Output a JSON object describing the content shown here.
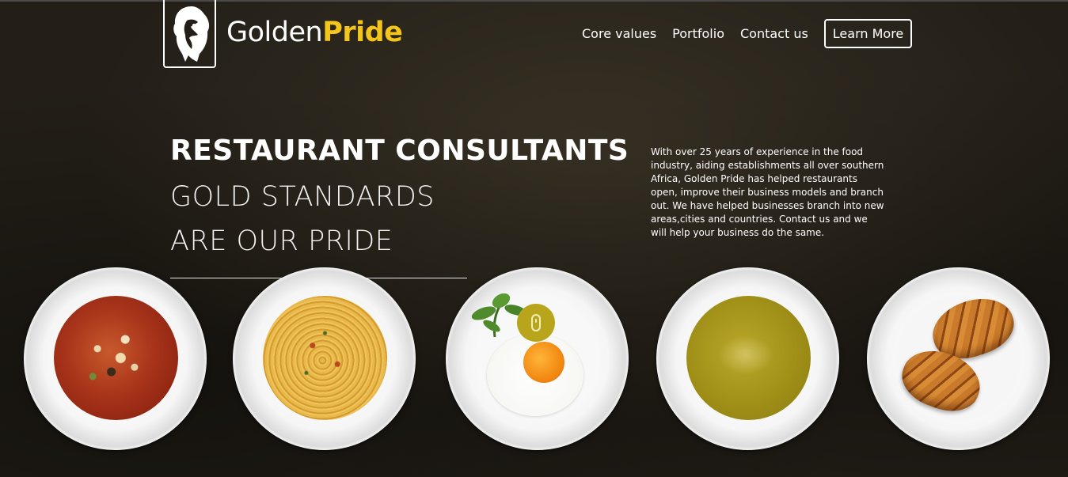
{
  "brand": {
    "name_part1": "Golden",
    "name_part2": "Pride",
    "accent_color": "#f4c51b",
    "logo_icon": "lion-head-icon"
  },
  "nav": {
    "items": [
      {
        "label": "Core values"
      },
      {
        "label": "Portfolio"
      },
      {
        "label": "Contact us"
      }
    ],
    "cta_label": "Learn More"
  },
  "hero": {
    "headline": "RESTAURANT CONSULTANTS",
    "subline_1": "GOLD STANDARDS",
    "subline_2": "ARE OUR PRIDE",
    "blurb": "With over 25 years of experience in the food industry, aiding establishments all over southern Africa, Golden Pride has helped restaurants open, improve their business models and branch out. We have helped businesses branch into new areas,cities and countries. Contact us and we will help your business do the same."
  },
  "plates": [
    {
      "dish": "vegetable-soup-icon"
    },
    {
      "dish": "spaghetti-icon"
    },
    {
      "dish": "fried-egg-icon"
    },
    {
      "dish": "green-soup-icon"
    },
    {
      "dish": "croissants-icon"
    }
  ],
  "scroll_indicator": {
    "icon": "mouse-scroll-icon",
    "color": "#b9a51c"
  }
}
